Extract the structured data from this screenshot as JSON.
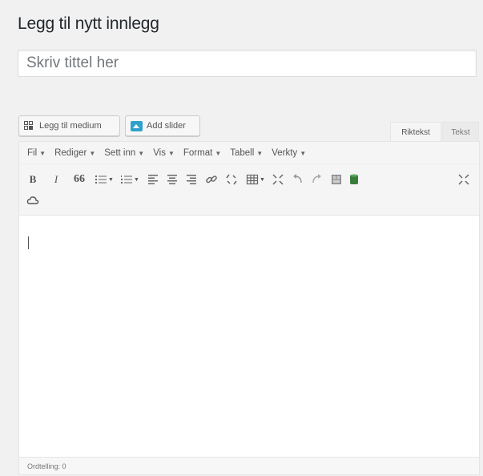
{
  "page": {
    "title": "Legg til nytt innlegg"
  },
  "title_input": {
    "placeholder": "Skriv tittel her",
    "value": ""
  },
  "media_buttons": {
    "add_media_label": "Legg til medium",
    "add_slider_label": "Add slider"
  },
  "editor_tabs": {
    "visual_label": "Riktekst",
    "text_label": "Tekst"
  },
  "menubar": {
    "items": [
      {
        "label": "Fil"
      },
      {
        "label": "Rediger"
      },
      {
        "label": "Sett inn"
      },
      {
        "label": "Vis"
      },
      {
        "label": "Format"
      },
      {
        "label": "Tabell"
      },
      {
        "label": "Verkty"
      }
    ]
  },
  "toolbar": {
    "bold_label": "B",
    "italic_label": "I",
    "blockquote_label": "66",
    "buttons": [
      "bold-icon",
      "italic-icon",
      "blockquote-icon",
      "bullet-list-icon",
      "numbered-list-icon",
      "align-left-icon",
      "align-center-icon",
      "align-right-icon",
      "link-icon",
      "unlink-icon",
      "table-icon",
      "fullscreen-icon",
      "undo-icon",
      "redo-icon",
      "image-gallery-icon",
      "database-icon",
      "distraction-free-icon",
      "cloud-icon"
    ]
  },
  "statusbar": {
    "word_count": "Ordtelling: 0"
  },
  "colors": {
    "background": "#f1f1f1",
    "accent": "#2ea2cc",
    "database_green": "#3a7d3a"
  }
}
